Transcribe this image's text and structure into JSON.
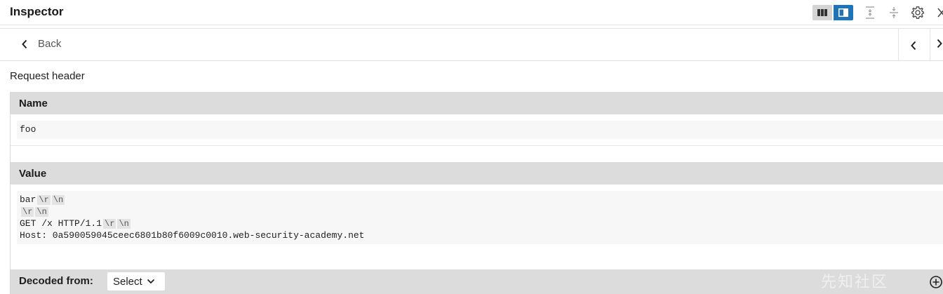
{
  "titlebar": {
    "title": "Inspector",
    "icons": [
      "layout-list-icon",
      "layout-sidebar-icon",
      "expand-all-icon",
      "collapse-all-icon",
      "gear-icon",
      "close-icon"
    ],
    "accent_color": "#1f73b7"
  },
  "nav": {
    "back_label": "Back",
    "icons": [
      "chevron-left-icon",
      "chevron-left-icon",
      "chevron-right-icon"
    ]
  },
  "section": {
    "title": "Request header"
  },
  "name_group": {
    "label": "Name",
    "value": "foo"
  },
  "value_group": {
    "label": "Value",
    "lines": [
      {
        "text": "bar",
        "escapes": [
          "\\r",
          "\\n"
        ]
      },
      {
        "text": "",
        "escapes": [
          "\\r",
          "\\n"
        ]
      },
      {
        "text": "GET /x HTTP/1.1",
        "escapes": [
          "\\r",
          "\\n"
        ]
      },
      {
        "text": "Host: 0a590059045ceec6801b80f6009c0010.web-security-academy.net",
        "escapes": []
      }
    ]
  },
  "decoded": {
    "label": "Decoded from:",
    "select_value": "Select",
    "icon": "add-circle-icon"
  },
  "watermark": "先知社区"
}
